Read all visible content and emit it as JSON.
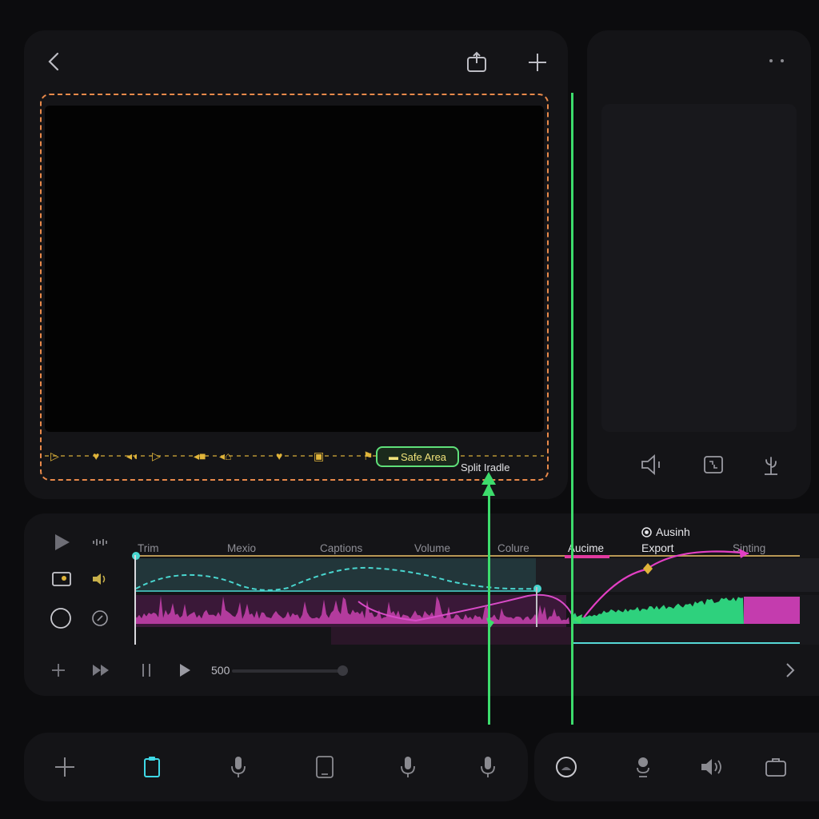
{
  "preview": {
    "safe_area_label": "Safe Area",
    "split_handle_label": "Split Iradle"
  },
  "timeline": {
    "tracks": [
      "Trim",
      "Mexio",
      "Captions",
      "Volume",
      "Colure",
      "Aucime",
      "Sinting"
    ],
    "autotrim_label": "Ausinh",
    "export_label": "Export",
    "timecode": "500",
    "scrub_position": 0.96
  },
  "icons": {
    "back": "chevron-left-icon",
    "share": "share-icon",
    "add": "plus-icon",
    "more": "more-dots-icon",
    "play": "play-icon",
    "pause": "pause-icon",
    "fast_forward": "fast-forward-icon",
    "next": "chevron-right-icon",
    "microphone": "microphone-icon",
    "speaker": "speaker-icon",
    "clipboard": "clipboard-icon"
  },
  "colors": {
    "safe_frame": "#e8894a",
    "playhead": "#3ddc6c",
    "audio_waveform": "#c13fa8",
    "audio_waveform_right": "#2ed17d",
    "volume_curve": "#49d6cf",
    "highlight": "#e23aa0",
    "accent_cyan": "#3fd8e6"
  }
}
